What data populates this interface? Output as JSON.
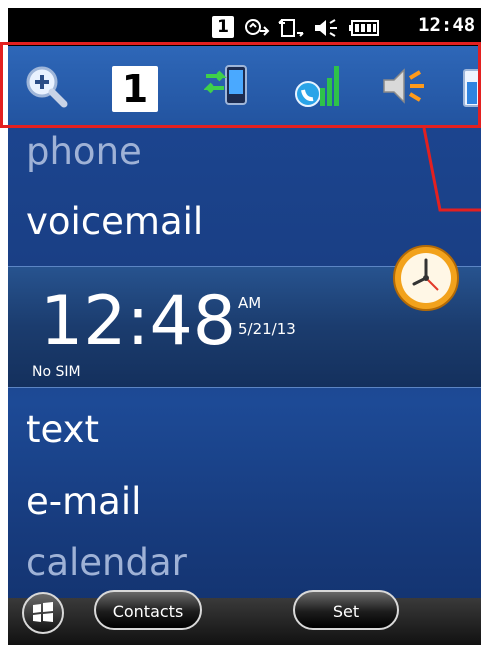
{
  "status_bar": {
    "sim_slot": "1",
    "time": "12:48",
    "icons": [
      "roaming-icon",
      "data-sync-icon",
      "speaker-icon",
      "battery-icon"
    ]
  },
  "toolbar": {
    "sim_slot": "1",
    "icons": [
      "zoom-in-icon",
      "sim-1-icon",
      "data-transfer-icon",
      "phone-signal-icon",
      "volume-icon",
      "battery-icon"
    ]
  },
  "menu_top": [
    "phone",
    "voicemail"
  ],
  "clock": {
    "time": "12:48",
    "ampm": "AM",
    "date": "5/21/13",
    "status": "No SIM"
  },
  "menu_bottom": [
    "text",
    "e-mail",
    "calendar"
  ],
  "softkeys": {
    "left": "Contacts",
    "right": "Set"
  },
  "colors": {
    "callout": "#e32020",
    "background": "#1c3f86"
  }
}
